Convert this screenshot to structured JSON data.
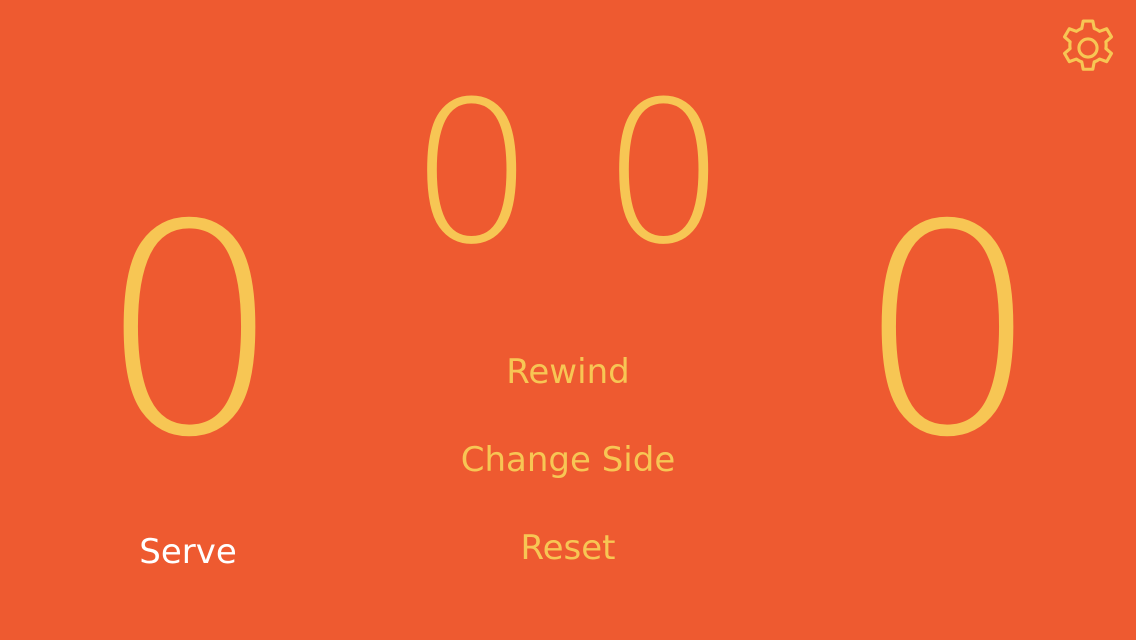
{
  "scoreboard": {
    "left_points": "0",
    "right_points": "0",
    "left_games": "0",
    "right_games": "0"
  },
  "actions": {
    "rewind": "Rewind",
    "change_side": "Change Side",
    "reset": "Reset"
  },
  "serve": {
    "label": "Serve"
  },
  "icons": {
    "settings": "gear-icon"
  },
  "colors": {
    "background": "#ee5a30",
    "accent": "#f7c654",
    "serve_text": "#ffffff"
  }
}
